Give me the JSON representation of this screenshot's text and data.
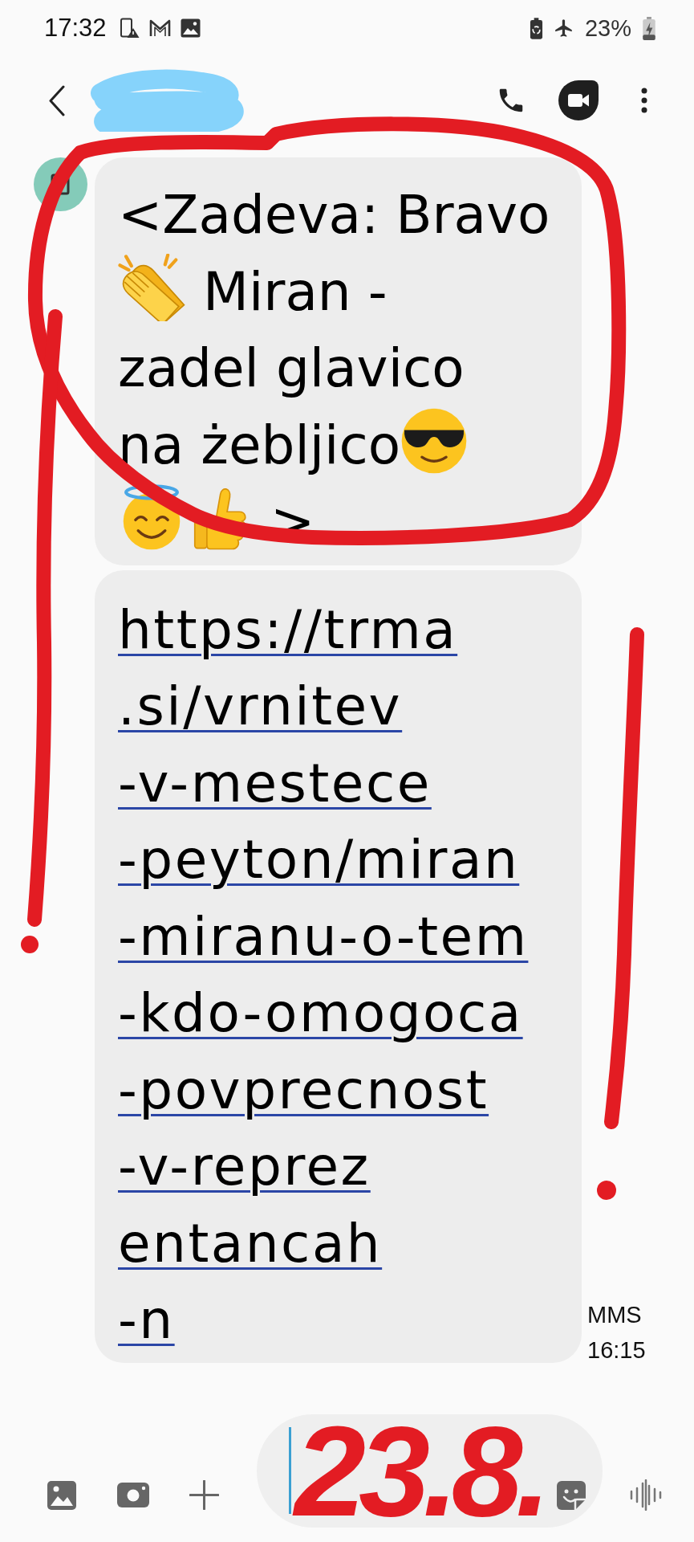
{
  "status_bar": {
    "time": "17:32",
    "battery": "23%"
  },
  "messages": [
    {
      "kind": "subject",
      "lines": [
        [
          {
            "kind": "text",
            "text": "<Zadeva: Bravo"
          }
        ],
        [
          {
            "kind": "clap"
          },
          {
            "kind": "text",
            "text": "Miran -"
          }
        ],
        [
          {
            "kind": "text",
            "text": "zadel glavico"
          }
        ],
        [
          {
            "kind": "text",
            "text": "na żebljico"
          },
          {
            "kind": "sunglasses"
          }
        ],
        [
          {
            "kind": "halo"
          },
          {
            "kind": "thumbsup"
          },
          {
            "kind": "text",
            "text": ">"
          }
        ]
      ]
    },
    {
      "kind": "link",
      "lines": [
        "https://trma",
        ".si/vrnitev",
        "-v-mestece",
        "-peyton/miran",
        "-miranu-o-tem",
        "-kdo-omogoca",
        "-povprecnost",
        "-v-reprez",
        "entancah",
        "-n"
      ]
    }
  ],
  "message_info": {
    "type": "MMS",
    "time": "16:15"
  },
  "annotation": {
    "handwritten": "23.8."
  }
}
